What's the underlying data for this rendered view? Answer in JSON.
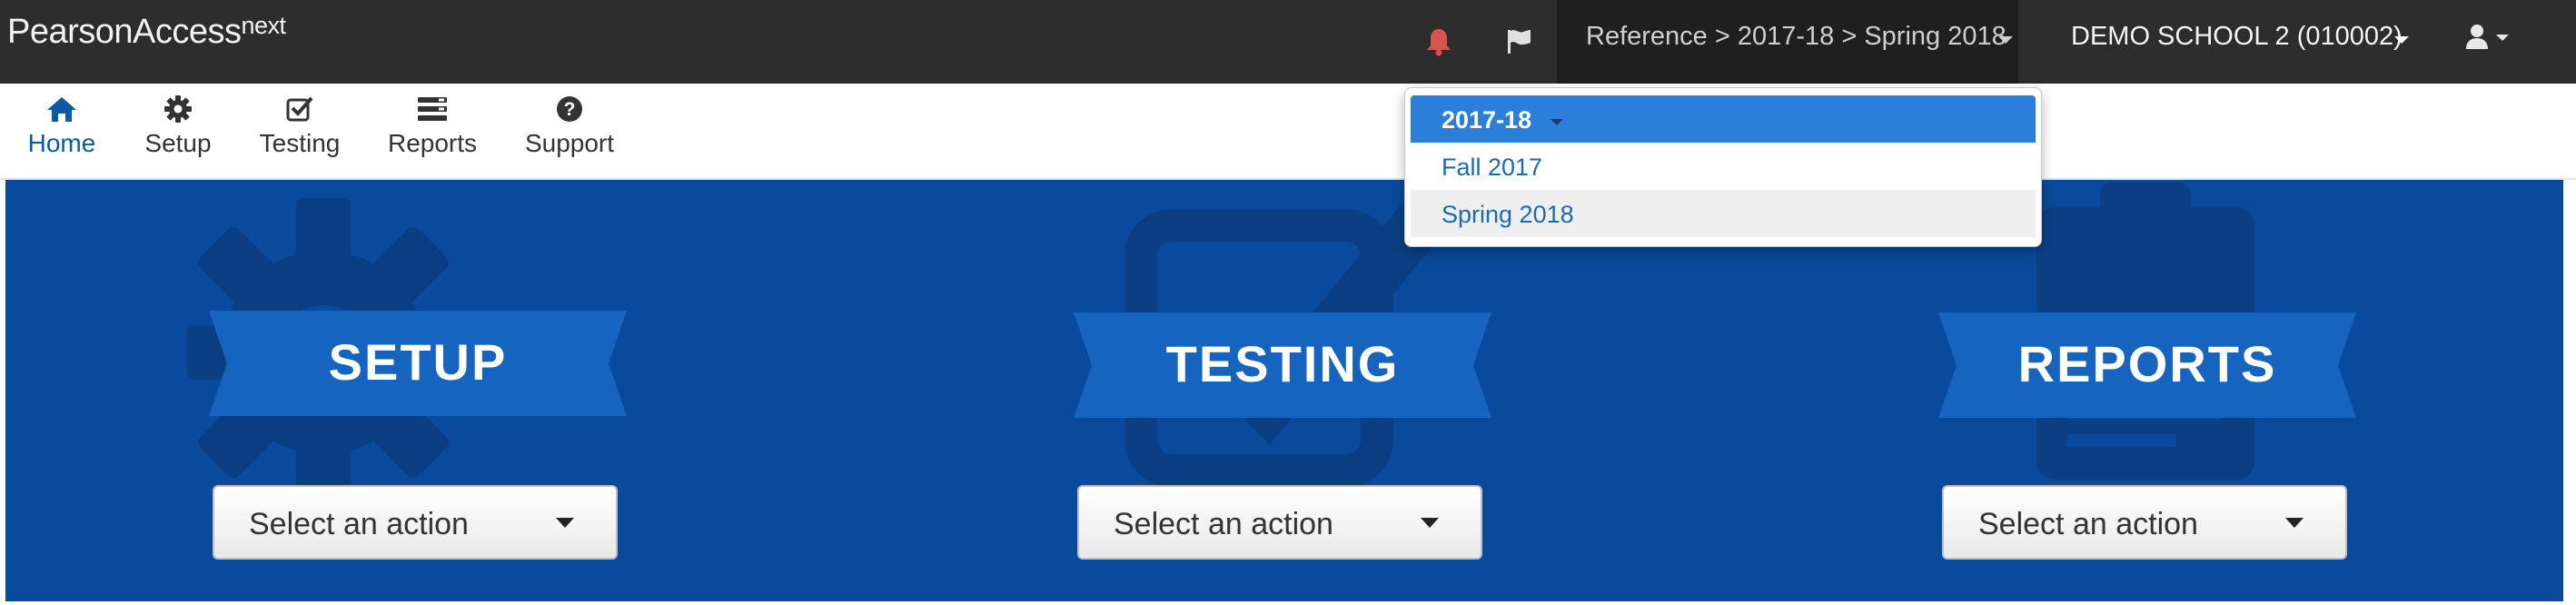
{
  "app": {
    "logo_main": "PearsonAccess",
    "logo_sup": "next"
  },
  "topbar": {
    "icons": [
      "bell-icon",
      "flag-icon",
      "user-icon"
    ],
    "context_label": "Reference > 2017-18 > Spring 2018",
    "school_label": "DEMO SCHOOL 2 (010002)",
    "colors": {
      "bar": "#2d2d2d",
      "alert": "#d9534f"
    }
  },
  "nav": {
    "items": [
      {
        "label": "Home",
        "icon": "home-icon",
        "active": true
      },
      {
        "label": "Setup",
        "icon": "gear-icon"
      },
      {
        "label": "Testing",
        "icon": "check-square-icon"
      },
      {
        "label": "Reports",
        "icon": "list-icon"
      },
      {
        "label": "Support",
        "icon": "question-circle-icon"
      }
    ]
  },
  "hero": {
    "colors": {
      "background": "#0a4a9c",
      "ribbon": "#1565c0"
    },
    "panels": [
      {
        "title": "SETUP",
        "action": "Select an action",
        "bg_icon": "gear-icon"
      },
      {
        "title": "TESTING",
        "action": "Select an action",
        "bg_icon": "check-square-icon"
      },
      {
        "title": "REPORTS",
        "action": "Select an action",
        "bg_icon": "clipboard-icon"
      }
    ]
  },
  "dropdown": {
    "header": "2017-18",
    "items": [
      "Fall 2017",
      "Spring 2018"
    ],
    "hovered": "Spring 2018"
  }
}
